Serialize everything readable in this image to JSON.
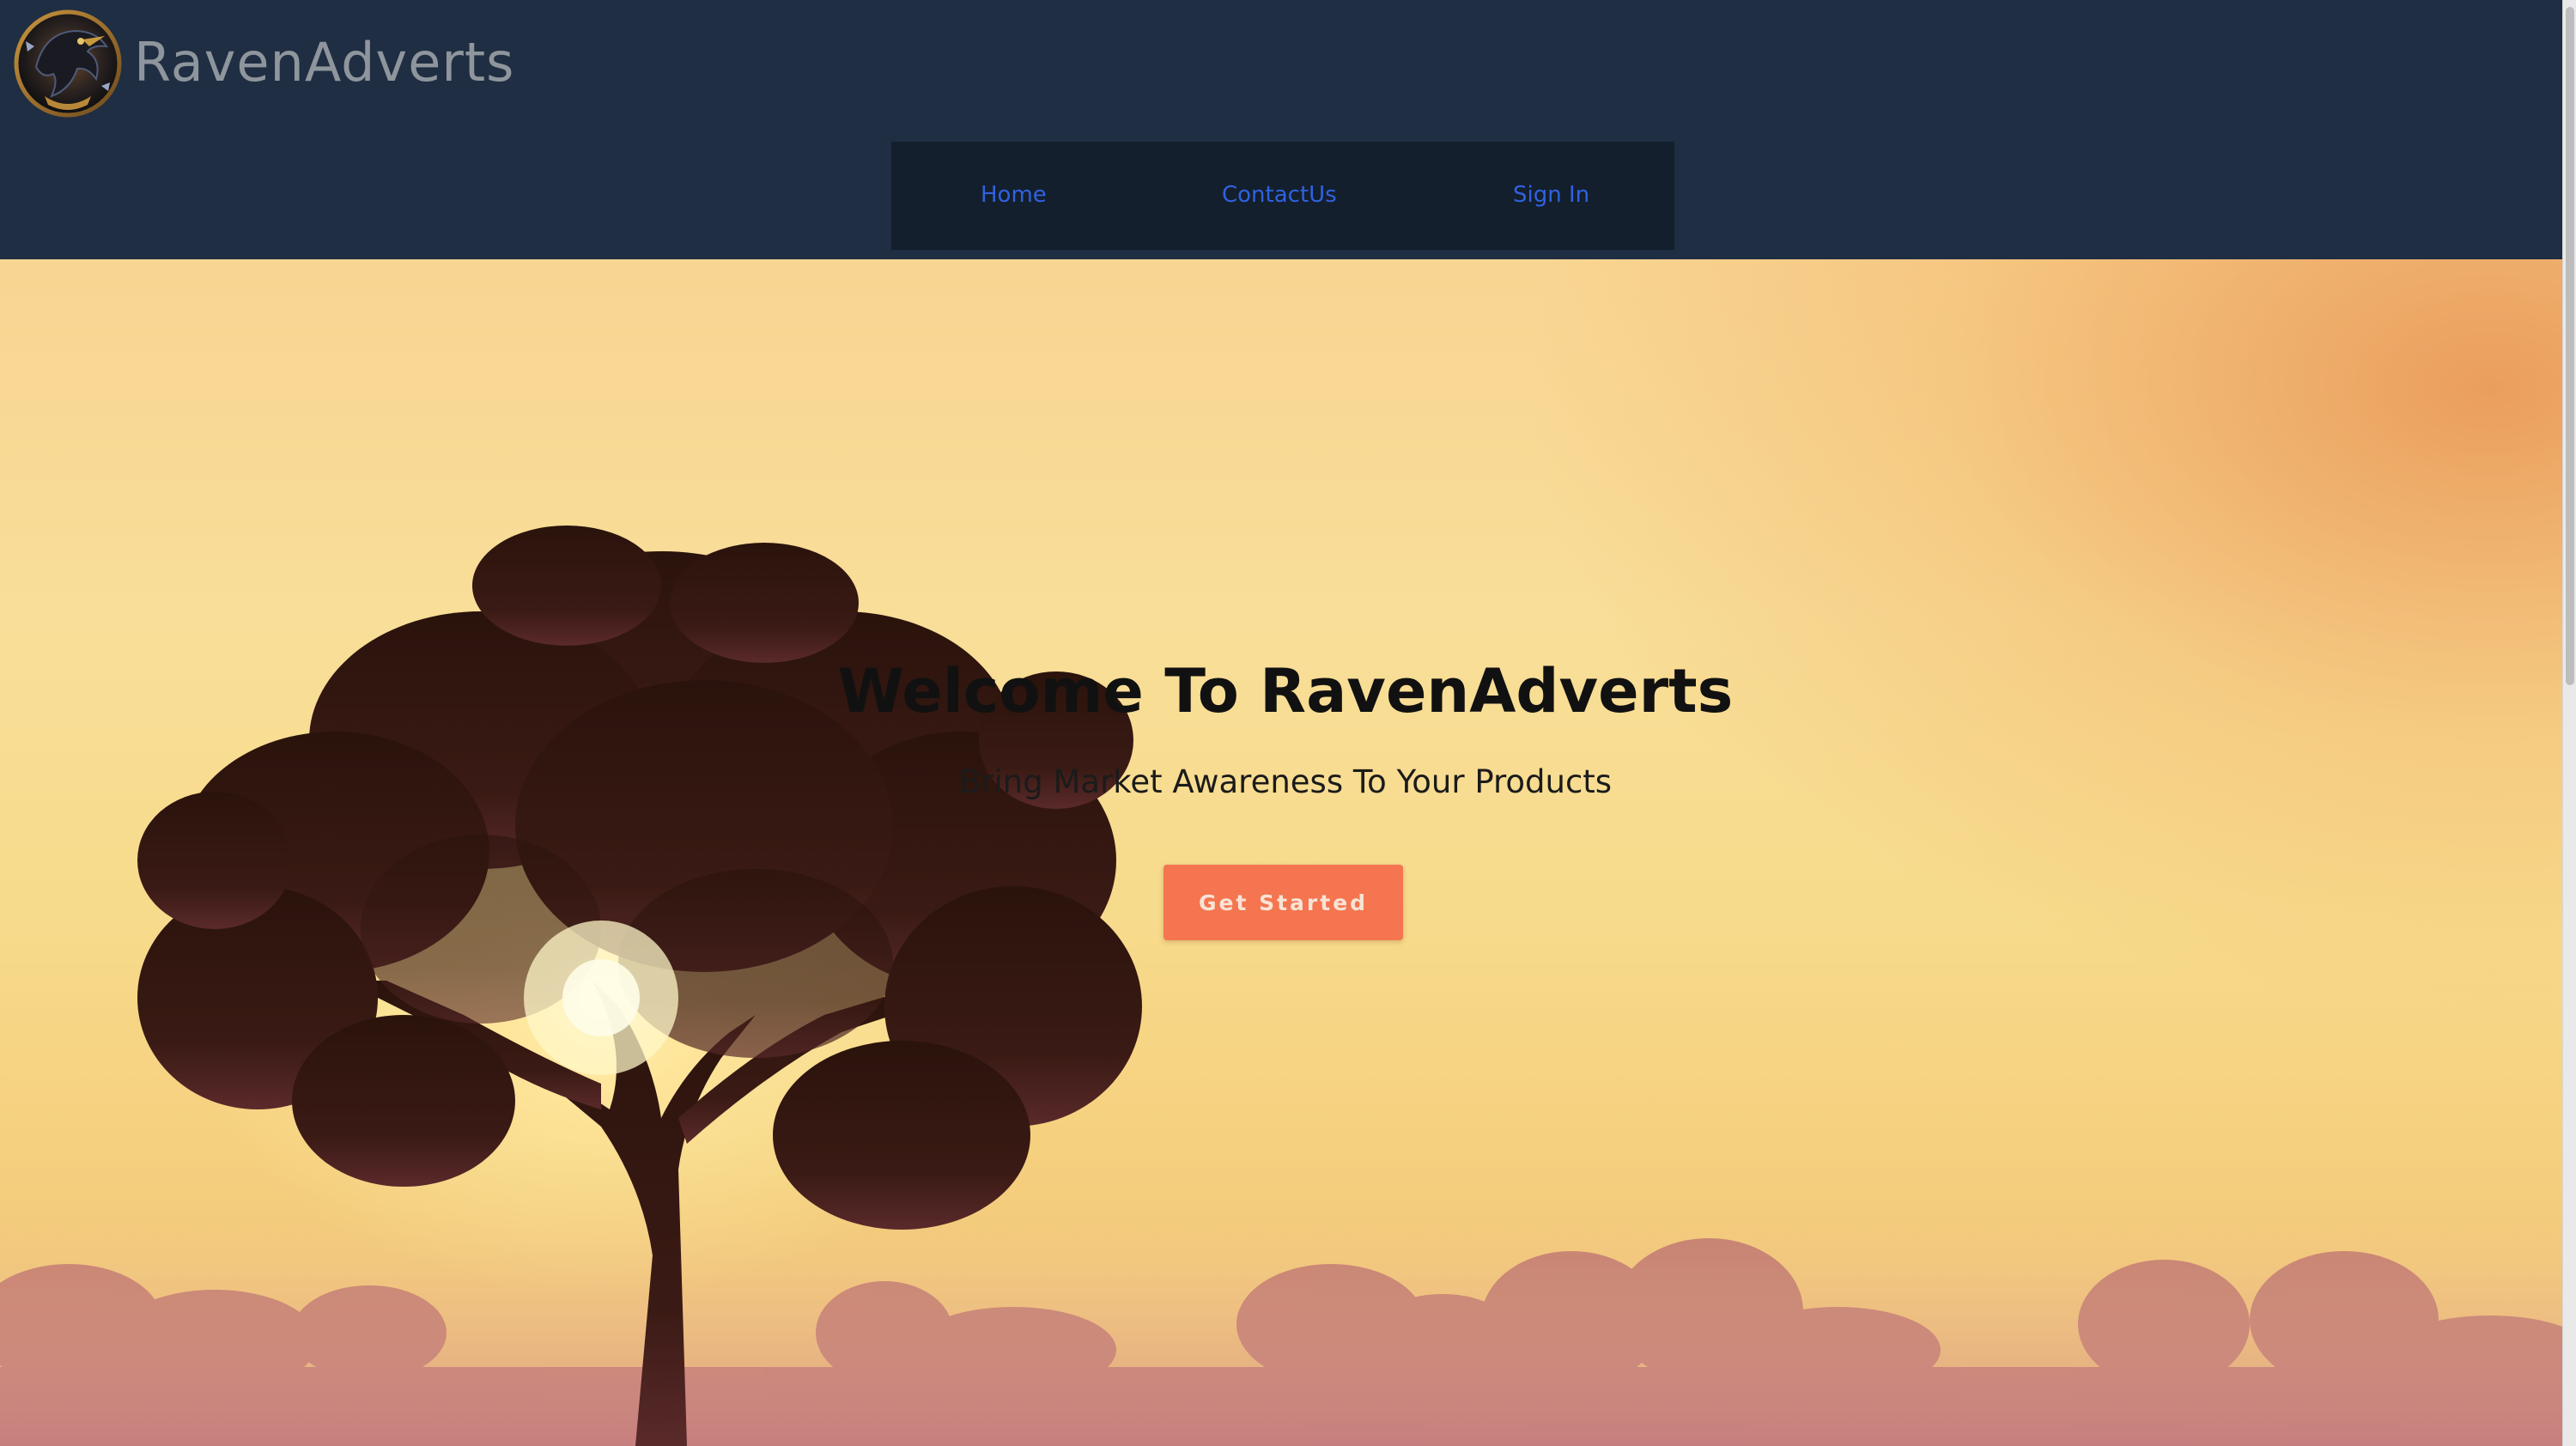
{
  "brand": {
    "name": "RavenAdverts",
    "logo_icon": "raven-emblem-icon"
  },
  "nav": {
    "items": [
      {
        "label": "Home"
      },
      {
        "label": "ContactUs"
      },
      {
        "label": "Sign In"
      }
    ]
  },
  "hero": {
    "title": "Welcome To RavenAdverts",
    "subtitle": "Bring Market Awareness To Your Products",
    "cta_label": "Get Started",
    "background": "sunset-tree-landscape"
  },
  "colors": {
    "header_bg": "#1f2e42",
    "nav_bg": "#141f2d",
    "nav_link": "#2f62e0",
    "cta_bg": "#f4754f",
    "brand_text": "#8f959c"
  }
}
